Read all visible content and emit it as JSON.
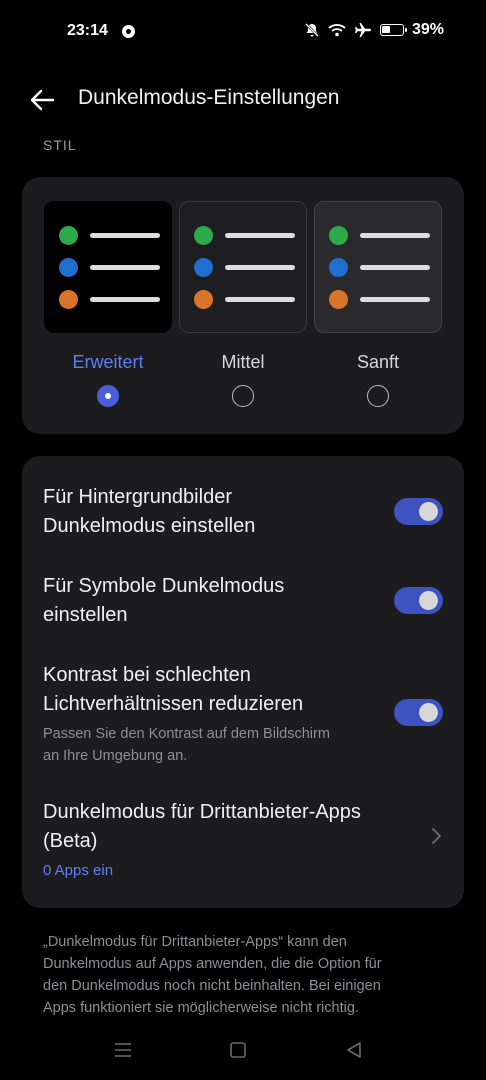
{
  "status": {
    "time": "23:14",
    "battery_percent": "39%",
    "battery_level": 0.39,
    "icons": [
      "message-icon",
      "bell-muted-icon",
      "wifi-icon",
      "airplane-icon",
      "battery-icon"
    ]
  },
  "header": {
    "title": "Dunkelmodus-Einstellungen",
    "back_icon": "arrow-left-icon"
  },
  "style_section": {
    "label": "STIL",
    "options": [
      {
        "label": "Erweitert",
        "selected": true
      },
      {
        "label": "Mittel",
        "selected": false
      },
      {
        "label": "Sanft",
        "selected": false
      }
    ],
    "preview_colors": [
      "#2eaa4a",
      "#1f6fd1",
      "#d9742a"
    ],
    "accent_color": "#5d7ef7"
  },
  "settings": {
    "wallpaper": {
      "title_line1": "Für Hintergrundbilder",
      "title_line2": "Dunkelmodus einstellen",
      "enabled": true
    },
    "icons": {
      "title_line1": "Für Symbole Dunkelmodus",
      "title_line2": "einstellen",
      "enabled": true
    },
    "contrast": {
      "title_line1": "Kontrast bei schlechten",
      "title_line2": "Lichtverhältnissen reduzieren",
      "desc_line1": "Passen Sie den Kontrast auf dem Bildschirm",
      "desc_line2": "an Ihre Umgebung an.",
      "enabled": true
    },
    "third_party": {
      "title_line1": "Dunkelmodus für Drittanbieter-Apps",
      "title_line2": "(Beta)",
      "link": "0 Apps ein"
    }
  },
  "footnote": {
    "line1": "„Dunkelmodus für Drittanbieter-Apps“ kann den",
    "line2": "Dunkelmodus auf Apps anwenden, die die Option für",
    "line3": "den Dunkelmodus noch nicht beinhalten. Bei einigen",
    "line4": "Apps funktioniert sie möglicherweise nicht richtig."
  },
  "navbar": {
    "icons": [
      "menu-icon",
      "home-icon",
      "back-triangle-icon"
    ]
  }
}
